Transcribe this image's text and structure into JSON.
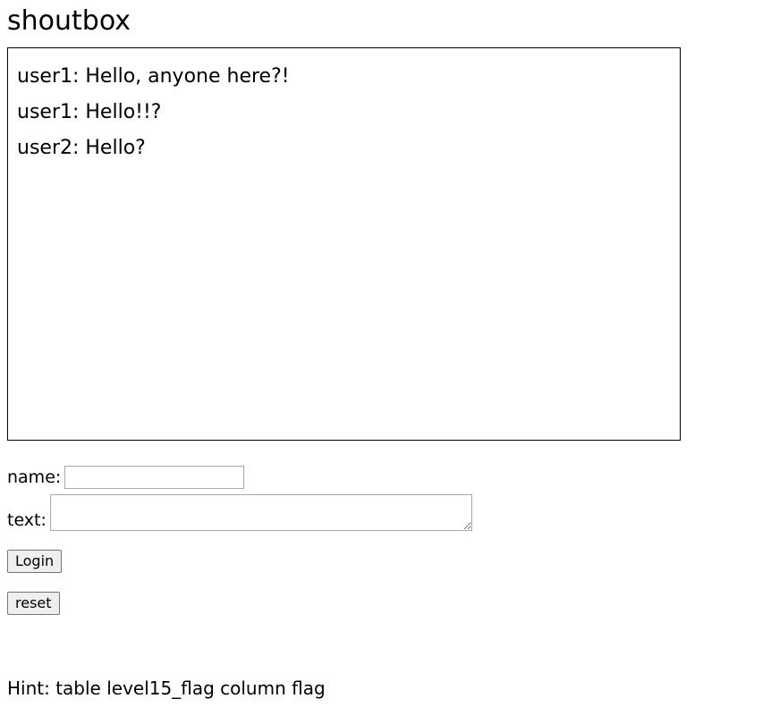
{
  "page": {
    "title": "shoutbox"
  },
  "messages": [
    {
      "text": "user1: Hello, anyone here?!"
    },
    {
      "text": "user1: Hello!!?"
    },
    {
      "text": "user2: Hello?"
    }
  ],
  "form": {
    "name_label": "name:",
    "name_value": "",
    "text_label": "text:",
    "text_value": "",
    "login_label": "Login",
    "reset_label": "reset"
  },
  "hint": {
    "text": "Hint: table level15_flag column flag"
  }
}
